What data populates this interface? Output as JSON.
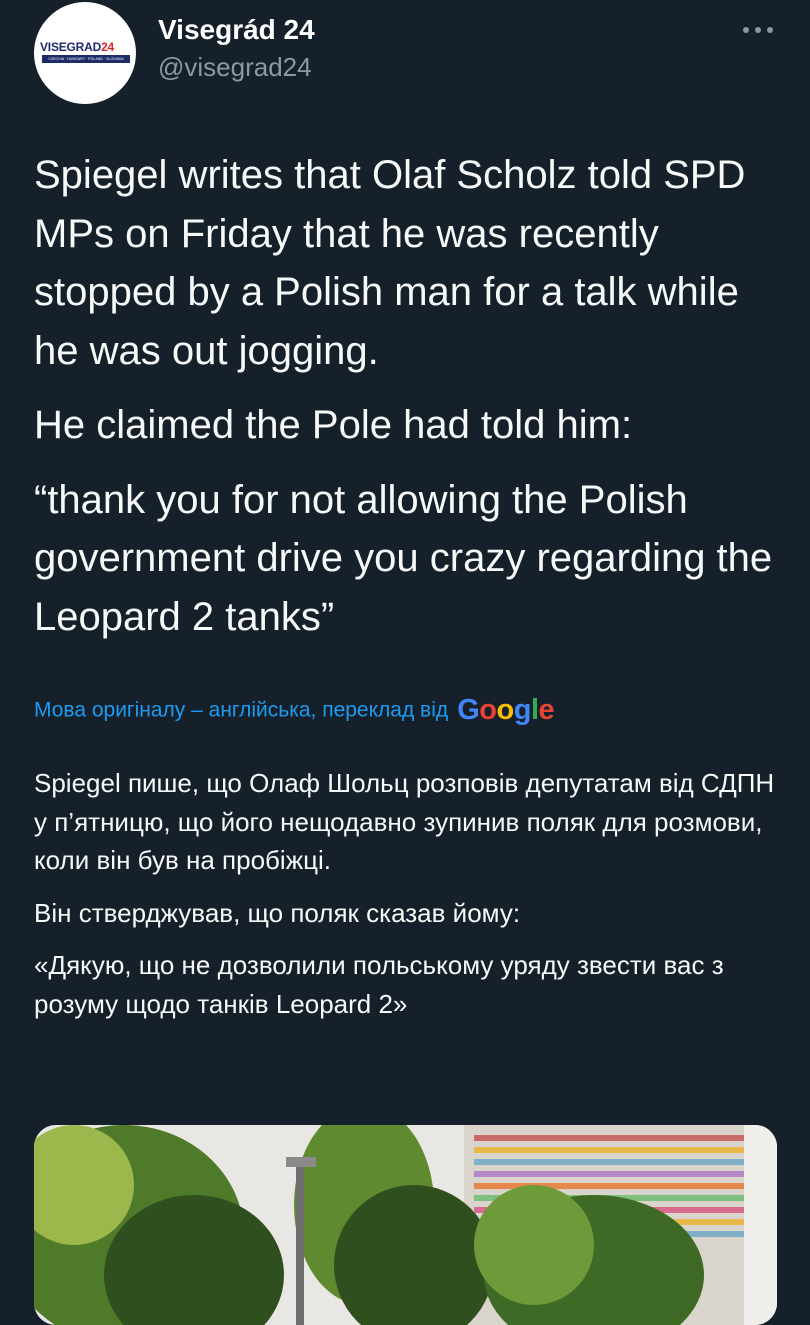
{
  "tweet": {
    "author": {
      "display_name": "Visegrád 24",
      "handle": "@visegrad24",
      "avatar": {
        "logo_word_a": "VISEGRAD",
        "logo_word_b": "24",
        "logo_countries": "CZECHIA · HUNGARY · POLAND · SLOVAKIA"
      }
    },
    "more_icon": "more-horizontal-icon",
    "text_paragraphs": [
      "Spiegel writes that Olaf Scholz told SPD MPs on Friday that he was recently stopped by a Polish man for a talk while he was out jogging.",
      "He claimed the Pole had told him:",
      "“thank you for not allowing the Polish government drive you crazy regarding the Leopard 2 tanks”"
    ],
    "translation": {
      "label": "Мова оригіналу – англійська, переклад від",
      "provider_letters": [
        "G",
        "o",
        "o",
        "g",
        "l",
        "e"
      ],
      "paragraphs": [
        "Spiegel пише, що Олаф Шольц розповів депутатам від СДПН у п’ятницю, що його нещодавно зупинив поляк для розмови, коли він був на пробіжці.",
        "Він стверджував, що поляк сказав йому:",
        "«Дякую, що не дозволили польському уряду звести вас з розуму щодо танків Leopard 2»"
      ]
    },
    "media": {
      "kind": "photo",
      "colors": {
        "sky": "#e9e7e3",
        "tree_dark": "#2f4f1f",
        "tree_mid": "#5f8a2f",
        "tree_light": "#9cb84c"
      }
    }
  },
  "colors": {
    "background": "#15202b",
    "text_primary": "#f7f9f9",
    "text_secondary": "#8b98a5",
    "link": "#1d9bf0",
    "brand_navy": "#1f2a6b",
    "brand_red": "#d8262c"
  }
}
